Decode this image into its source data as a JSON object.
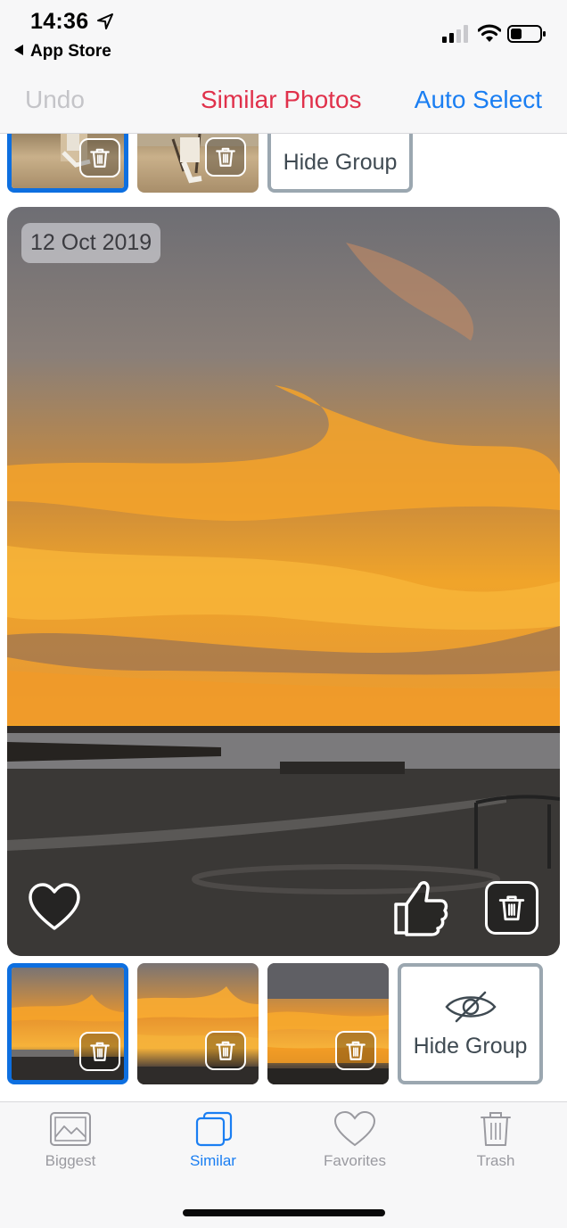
{
  "status": {
    "time": "14:36",
    "back_label": "App Store"
  },
  "nav": {
    "undo": "Undo",
    "title": "Similar Photos",
    "auto_select": "Auto Select"
  },
  "groups": [
    {
      "hide_label": "Hide Group"
    },
    {
      "hide_label": "Hide Group"
    }
  ],
  "main_photo": {
    "date": "12 Oct 2019"
  },
  "tabs": [
    {
      "label": "Biggest",
      "icon": "photo-icon",
      "active": false
    },
    {
      "label": "Similar",
      "icon": "similar-stack-icon",
      "active": true
    },
    {
      "label": "Favorites",
      "icon": "heart-icon",
      "active": false
    },
    {
      "label": "Trash",
      "icon": "trash-icon",
      "active": false
    }
  ],
  "colors": {
    "accent_blue": "#1a7ef2",
    "title_red": "#e0314b",
    "disabled_gray": "#c4c4c8",
    "selection_blue": "#0d6fe0"
  }
}
